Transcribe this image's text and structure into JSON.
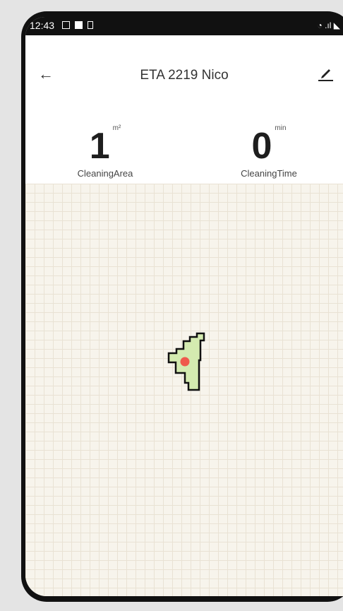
{
  "status": {
    "time": "12:43"
  },
  "header": {
    "title": "ETA 2219 Nico"
  },
  "stats": {
    "area": {
      "value": "1",
      "unit": "m²",
      "label": "CleaningArea"
    },
    "time": {
      "value": "0",
      "unit": "min",
      "label": "CleaningTime"
    }
  },
  "colors": {
    "cleaned_area": "#d4ebb0",
    "robot": "#ef5a4c",
    "grid": "#e9e2d4",
    "map_bg": "#f7f4ec"
  },
  "icons": {
    "back": "arrow-left-icon",
    "edit": "pencil-icon"
  }
}
